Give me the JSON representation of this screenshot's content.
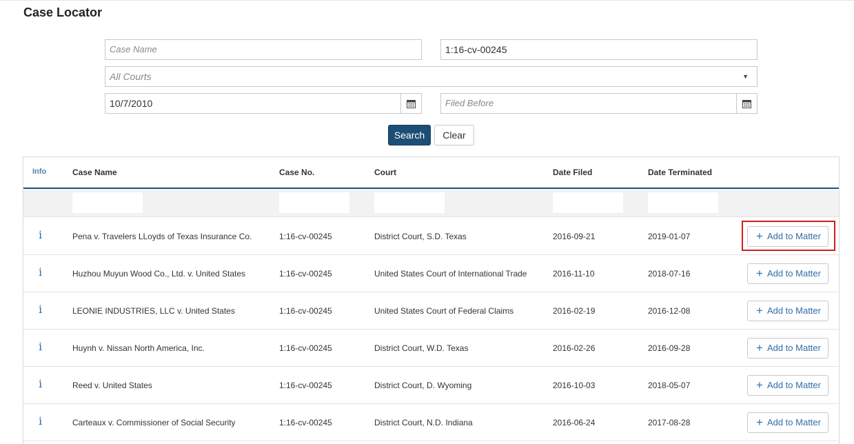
{
  "page_title": "Case Locator",
  "search": {
    "case_name_placeholder": "Case Name",
    "case_number_value": "1:16-cv-00245",
    "court_select_value": "All Courts",
    "filed_after_value": "10/7/2010",
    "filed_before_placeholder": "Filed Before",
    "search_label": "Search",
    "clear_label": "Clear"
  },
  "table": {
    "headers": {
      "info": "Info",
      "case_name": "Case Name",
      "case_no": "Case No.",
      "court": "Court",
      "date_filed": "Date Filed",
      "date_terminated": "Date Terminated"
    },
    "info_glyph": "i",
    "add_label": "Add to Matter",
    "add_icon": "plus-icon",
    "rows": [
      {
        "case_name": "Pena v. Travelers LLoyds of Texas Insurance Co.",
        "case_no": "1:16-cv-00245",
        "court": "District Court, S.D. Texas",
        "date_filed": "2016-09-21",
        "date_terminated": "2019-01-07"
      },
      {
        "case_name": "Huzhou Muyun Wood Co., Ltd. v. United States",
        "case_no": "1:16-cv-00245",
        "court": "United States Court of International Trade",
        "date_filed": "2016-11-10",
        "date_terminated": "2018-07-16"
      },
      {
        "case_name": "LEONIE INDUSTRIES, LLC v. United States",
        "case_no": "1:16-cv-00245",
        "court": "United States Court of Federal Claims",
        "date_filed": "2016-02-19",
        "date_terminated": "2016-12-08"
      },
      {
        "case_name": "Huynh v. Nissan North America, Inc.",
        "case_no": "1:16-cv-00245",
        "court": "District Court, W.D. Texas",
        "date_filed": "2016-02-26",
        "date_terminated": "2016-09-28"
      },
      {
        "case_name": "Reed v. United States",
        "case_no": "1:16-cv-00245",
        "court": "District Court, D. Wyoming",
        "date_filed": "2016-10-03",
        "date_terminated": "2018-05-07"
      },
      {
        "case_name": "Carteaux v. Commissioner of Social Security",
        "case_no": "1:16-cv-00245",
        "court": "District Court, N.D. Indiana",
        "date_filed": "2016-06-24",
        "date_terminated": "2017-08-28"
      }
    ]
  },
  "colors": {
    "primary": "#1d4e75",
    "link": "#2f6ea5",
    "highlight": "#d41c1c"
  }
}
